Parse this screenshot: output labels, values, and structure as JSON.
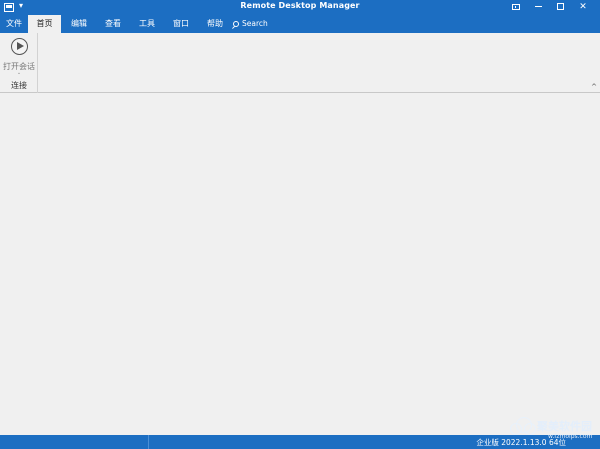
{
  "window": {
    "title": "Remote Desktop Manager",
    "qa_caret": "▾",
    "controls": {
      "restore_glyph": "⧉"
    }
  },
  "menu": {
    "items": [
      {
        "label": "文件"
      },
      {
        "label": "首页",
        "active": true
      },
      {
        "label": "编辑"
      },
      {
        "label": "查看"
      },
      {
        "label": "工具"
      },
      {
        "label": "窗口"
      },
      {
        "label": "帮助"
      }
    ],
    "search_label": "Search"
  },
  "ribbon": {
    "open_session_label": "打开会话",
    "open_session_caret": "⌄",
    "group_label": "连接",
    "collapse_caret": "^"
  },
  "status": {
    "edition_version": "企业版 2022.1.13.0 64位"
  },
  "watermark": {
    "title": "聚美软件园",
    "url": "w.fzmoips.com"
  },
  "colors": {
    "accent": "#1c6ec2",
    "background": "#f0f0f0"
  },
  "icons": [
    "app-icon",
    "search-icon",
    "play-icon",
    "minimize-icon",
    "maximize-icon",
    "close-icon",
    "restore-icon"
  ]
}
